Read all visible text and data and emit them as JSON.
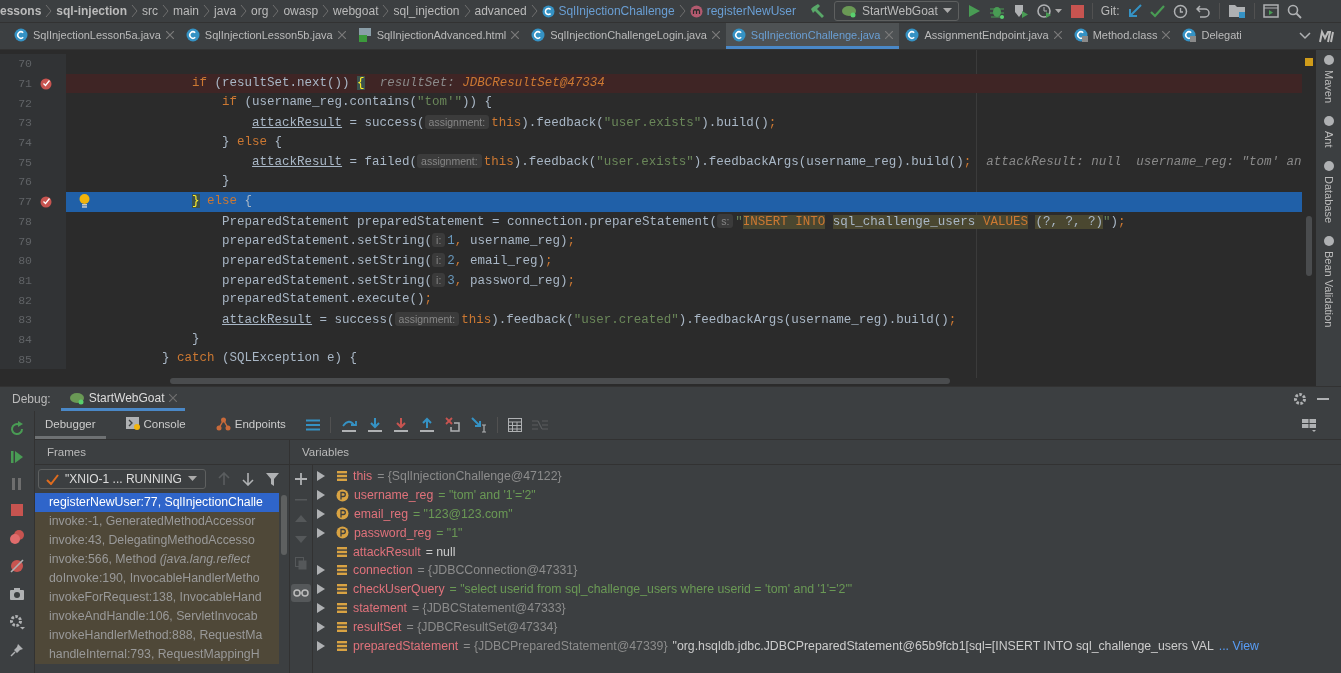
{
  "breadcrumbs": [
    {
      "text": "essons",
      "kind": "module"
    },
    {
      "text": "sql-injection",
      "kind": "module"
    },
    {
      "text": "src",
      "kind": "folder"
    },
    {
      "text": "main",
      "kind": "folder"
    },
    {
      "text": "java",
      "kind": "folder"
    },
    {
      "text": "org",
      "kind": "folder"
    },
    {
      "text": "owasp",
      "kind": "folder"
    },
    {
      "text": "webgoat",
      "kind": "folder"
    },
    {
      "text": "sql_injection",
      "kind": "folder"
    },
    {
      "text": "advanced",
      "kind": "folder"
    },
    {
      "text": "SqlInjectionChallenge",
      "kind": "class"
    },
    {
      "text": "registerNewUser",
      "kind": "method"
    }
  ],
  "run_configuration": "StartWebGoat",
  "git_label": "Git:",
  "tabs": [
    {
      "label": "SqlInjectionLesson5a.java",
      "kind": "java",
      "selected": false
    },
    {
      "label": "SqlInjectionLesson5b.java",
      "kind": "java",
      "selected": false
    },
    {
      "label": "SqlInjectionAdvanced.html",
      "kind": "html",
      "selected": false
    },
    {
      "label": "SqlInjectionChallengeLogin.java",
      "kind": "java",
      "selected": false
    },
    {
      "label": "SqlInjectionChallenge.java",
      "kind": "java",
      "selected": true
    },
    {
      "label": "AssignmentEndpoint.java",
      "kind": "java",
      "selected": false
    },
    {
      "label": "Method.class",
      "kind": "class",
      "selected": false
    },
    {
      "label": "Delegati",
      "kind": "class",
      "selected": false
    }
  ],
  "code_lines": [
    {
      "number": "70",
      "breakpoint": false,
      "current": false,
      "bulb": false
    },
    {
      "number": "71",
      "breakpoint": true,
      "current": false,
      "bulb": false,
      "tokens": [
        {
          "kind": "keyword",
          "text": "                if"
        },
        {
          "kind": "plain",
          "text": " (resultSet.next()) "
        },
        {
          "kind": "brace",
          "text": "{"
        },
        {
          "kind": "inline",
          "text": "  resultSet: "
        },
        {
          "kind": "inline_value",
          "text": "JDBCResultSet@47334"
        }
      ]
    },
    {
      "number": "72",
      "breakpoint": false,
      "current": false,
      "bulb": false,
      "tokens": [
        {
          "kind": "keyword",
          "text": "                    if"
        },
        {
          "kind": "plain",
          "text": " (username_reg.contains("
        },
        {
          "kind": "string",
          "text": "\"tom'\""
        },
        {
          "kind": "plain",
          "text": ")) {"
        }
      ]
    },
    {
      "number": "73",
      "breakpoint": false,
      "current": false,
      "bulb": false,
      "tokens": [
        {
          "kind": "field",
          "text": "                        attackResult"
        },
        {
          "kind": "plain",
          "text": " = success("
        },
        {
          "kind": "hint",
          "text": "assignment:"
        },
        {
          "kind": "keyword",
          "text": "this"
        },
        {
          "kind": "plain",
          "text": ").feedback("
        },
        {
          "kind": "string",
          "text": "\"user.exists\""
        },
        {
          "kind": "plain",
          "text": ").build()"
        },
        {
          "kind": "punct",
          "text": ";"
        }
      ]
    },
    {
      "number": "74",
      "breakpoint": false,
      "current": false,
      "bulb": false,
      "tokens": [
        {
          "kind": "plain",
          "text": "                    } "
        },
        {
          "kind": "keyword",
          "text": "else"
        },
        {
          "kind": "plain",
          "text": " {"
        }
      ]
    },
    {
      "number": "75",
      "breakpoint": false,
      "current": false,
      "bulb": false,
      "tokens": [
        {
          "kind": "field",
          "text": "                        attackResult"
        },
        {
          "kind": "plain",
          "text": " = failed("
        },
        {
          "kind": "hint",
          "text": "assignment:"
        },
        {
          "kind": "keyword",
          "text": "this"
        },
        {
          "kind": "plain",
          "text": ").feedback("
        },
        {
          "kind": "string",
          "text": "\"user.exists\""
        },
        {
          "kind": "plain",
          "text": ").feedbackArgs(username_reg).build()"
        },
        {
          "kind": "punct",
          "text": ";"
        },
        {
          "kind": "inline",
          "text": "  attackResult: null  username_reg: \"tom' an"
        }
      ]
    },
    {
      "number": "76",
      "breakpoint": false,
      "current": false,
      "bulb": false,
      "tokens": [
        {
          "kind": "plain",
          "text": "                    }"
        }
      ]
    },
    {
      "number": "77",
      "breakpoint": true,
      "current": true,
      "bulb": true,
      "tokens": [
        {
          "kind": "brace",
          "text": "                }"
        },
        {
          "kind": "keyword",
          "text": " else"
        },
        {
          "kind": "plain",
          "text": " {"
        }
      ]
    },
    {
      "number": "78",
      "breakpoint": false,
      "current": false,
      "bulb": false,
      "tokens": [
        {
          "kind": "plain",
          "text": "                    PreparedStatement preparedStatement = connection.prepareStatement("
        },
        {
          "kind": "hint",
          "text": "s:"
        },
        {
          "kind": "string",
          "text": "\""
        },
        {
          "kind": "sql_keyword",
          "text": "INSERT INTO"
        },
        {
          "kind": "sql",
          "text": " sql_challenge_users "
        },
        {
          "kind": "sql_keyword",
          "text": "VALUES"
        },
        {
          "kind": "sql",
          "text": " (?, ?, ?)"
        },
        {
          "kind": "string",
          "text": "\""
        },
        {
          "kind": "plain",
          "text": ")"
        },
        {
          "kind": "punct",
          "text": ";"
        }
      ]
    },
    {
      "number": "79",
      "breakpoint": false,
      "current": false,
      "bulb": false,
      "tokens": [
        {
          "kind": "plain",
          "text": "                    preparedStatement.setString("
        },
        {
          "kind": "hint",
          "text": "i:"
        },
        {
          "kind": "number",
          "text": "1"
        },
        {
          "kind": "punct",
          "text": ","
        },
        {
          "kind": "plain",
          "text": " username_reg)"
        },
        {
          "kind": "punct",
          "text": ";"
        }
      ]
    },
    {
      "number": "80",
      "breakpoint": false,
      "current": false,
      "bulb": false,
      "tokens": [
        {
          "kind": "plain",
          "text": "                    preparedStatement.setString("
        },
        {
          "kind": "hint",
          "text": "i:"
        },
        {
          "kind": "number",
          "text": "2"
        },
        {
          "kind": "punct",
          "text": ","
        },
        {
          "kind": "plain",
          "text": " email_reg)"
        },
        {
          "kind": "punct",
          "text": ";"
        }
      ]
    },
    {
      "number": "81",
      "breakpoint": false,
      "current": false,
      "bulb": false,
      "tokens": [
        {
          "kind": "plain",
          "text": "                    preparedStatement.setString("
        },
        {
          "kind": "hint",
          "text": "i:"
        },
        {
          "kind": "number",
          "text": "3"
        },
        {
          "kind": "punct",
          "text": ","
        },
        {
          "kind": "plain",
          "text": " password_reg)"
        },
        {
          "kind": "punct",
          "text": ";"
        }
      ]
    },
    {
      "number": "82",
      "breakpoint": false,
      "current": false,
      "bulb": false,
      "tokens": [
        {
          "kind": "plain",
          "text": "                    preparedStatement.execute()"
        },
        {
          "kind": "punct",
          "text": ";"
        }
      ]
    },
    {
      "number": "83",
      "breakpoint": false,
      "current": false,
      "bulb": false,
      "tokens": [
        {
          "kind": "field",
          "text": "                    attackResult"
        },
        {
          "kind": "plain",
          "text": " = success("
        },
        {
          "kind": "hint",
          "text": "assignment:"
        },
        {
          "kind": "keyword",
          "text": "this"
        },
        {
          "kind": "plain",
          "text": ").feedback("
        },
        {
          "kind": "string",
          "text": "\"user.created\""
        },
        {
          "kind": "plain",
          "text": ").feedbackArgs(username_reg).build()"
        },
        {
          "kind": "punct",
          "text": ";"
        }
      ]
    },
    {
      "number": "84",
      "breakpoint": false,
      "current": false,
      "bulb": false,
      "tokens": [
        {
          "kind": "plain",
          "text": "                }"
        }
      ]
    },
    {
      "number": "85",
      "breakpoint": false,
      "current": false,
      "bulb": false,
      "tokens": [
        {
          "kind": "plain",
          "text": "            } "
        },
        {
          "kind": "keyword",
          "text": "catch"
        },
        {
          "kind": "plain",
          "text": " (SQLException e) {"
        }
      ]
    }
  ],
  "side_tools": [
    "Maven",
    "Ant",
    "Database",
    "Bean Validation"
  ],
  "debug": {
    "label": "Debug:",
    "session": "StartWebGoat",
    "tabs": [
      {
        "label": "Debugger",
        "kind": "debugger",
        "selected": true
      },
      {
        "label": "Console",
        "kind": "console",
        "selected": false
      },
      {
        "label": "Endpoints",
        "kind": "endpoints",
        "selected": false
      }
    ],
    "frames_title": "Frames",
    "thread": "\"XNIO-1 ... RUNNING",
    "frames": [
      {
        "text": "registerNewUser:77, SqlInjectionChalle",
        "library": false,
        "selected": true
      },
      {
        "text": "invoke:-1, GeneratedMethodAccessor",
        "library": true,
        "selected": false
      },
      {
        "text": "invoke:43, DelegatingMethodAccesso",
        "library": true,
        "selected": false
      },
      {
        "text": "invoke:566, Method *(java.lang.reflect*",
        "library": true,
        "selected": false
      },
      {
        "text": "doInvoke:190, InvocableHandlerMetho",
        "library": true,
        "selected": false
      },
      {
        "text": "invokeForRequest:138, InvocableHand",
        "library": true,
        "selected": false
      },
      {
        "text": "invokeAndHandle:106, ServletInvocab",
        "library": true,
        "selected": false
      },
      {
        "text": "invokeHandlerMethod:888, RequestMa",
        "library": true,
        "selected": false
      },
      {
        "text": "handleInternal:793, RequestMappingH",
        "library": true,
        "selected": false
      }
    ],
    "variables_title": "Variables",
    "variables": [
      {
        "name": "this",
        "kind": "field",
        "expandable": true,
        "value": {
          "kind": "object",
          "text": "= {SqlInjectionChallenge@47122}"
        }
      },
      {
        "name": "username_reg",
        "kind": "parameter",
        "expandable": true,
        "value": {
          "kind": "string",
          "text": "= \"tom' and '1'='2\""
        }
      },
      {
        "name": "email_reg",
        "kind": "parameter",
        "expandable": true,
        "value": {
          "kind": "string",
          "text": "= \"123@123.com\""
        }
      },
      {
        "name": "password_reg",
        "kind": "parameter",
        "expandable": true,
        "value": {
          "kind": "string",
          "text": "= \"1\""
        }
      },
      {
        "name": "attackResult",
        "kind": "field",
        "expandable": false,
        "value": {
          "kind": "null",
          "text": "= null"
        }
      },
      {
        "name": "connection",
        "kind": "field",
        "expandable": true,
        "value": {
          "kind": "object",
          "text": "= {JDBCConnection@47331}"
        }
      },
      {
        "name": "checkUserQuery",
        "kind": "field",
        "expandable": true,
        "value": {
          "kind": "string",
          "text": "= \"select userid from sql_challenge_users where userid = 'tom' and '1'='2'\""
        }
      },
      {
        "name": "statement",
        "kind": "field",
        "expandable": true,
        "value": {
          "kind": "object",
          "text": "= {JDBCStatement@47333}"
        }
      },
      {
        "name": "resultSet",
        "kind": "field",
        "expandable": true,
        "value": {
          "kind": "object",
          "text": "= {JDBCResultSet@47334}"
        }
      },
      {
        "name": "preparedStatement",
        "kind": "field",
        "expandable": true,
        "value": {
          "kind": "object",
          "text": "= {JDBCPreparedStatement@47339}"
        },
        "to_string": "\"org.hsqldb.jdbc.JDBCPreparedStatement@65b9fcb1[sql=[INSERT INTO sql_challenge_users VAL",
        "link": "... View"
      }
    ]
  }
}
